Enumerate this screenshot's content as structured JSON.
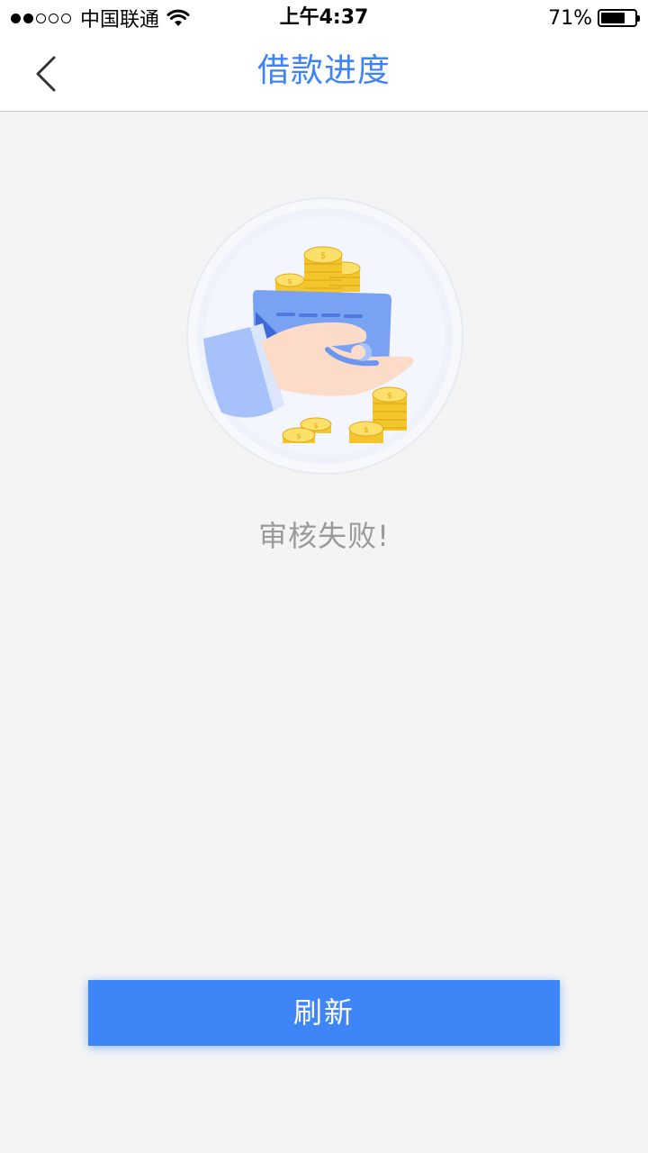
{
  "status_bar": {
    "carrier": "中国联通",
    "time": "上午4:37",
    "battery_percent": "71%",
    "battery_level": 0.71,
    "signal_strength_of_5": 2,
    "icons": [
      "signal-dots-icon",
      "wifi-icon",
      "battery-icon"
    ]
  },
  "nav": {
    "title": "借款进度",
    "back_icon": "chevron-left-icon"
  },
  "main": {
    "illustration": "hand-with-card-and-coins-illustration",
    "status_message": "审核失败!"
  },
  "footer": {
    "refresh_label": "刷新"
  },
  "colors": {
    "accent": "#3e83f5",
    "button": "#3e86f8",
    "background": "#f4f4f4",
    "message": "#9a9a9a"
  }
}
